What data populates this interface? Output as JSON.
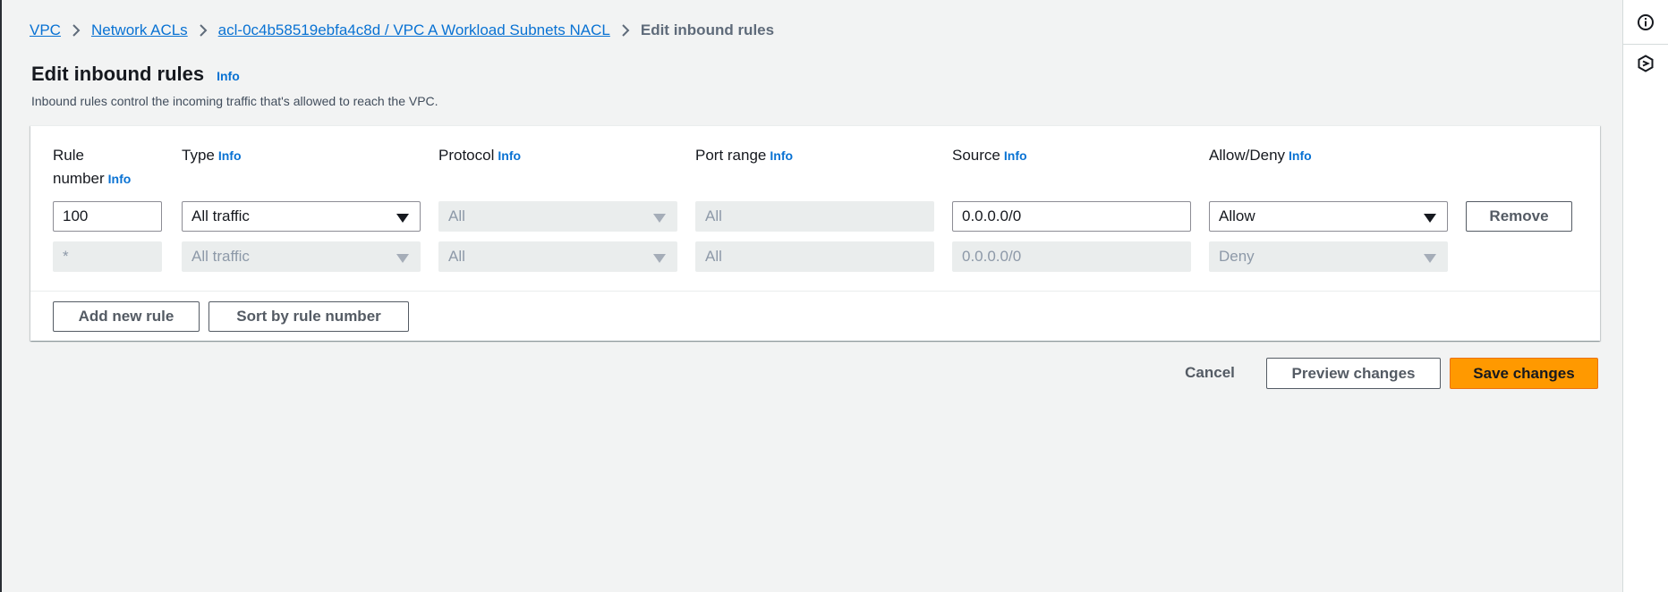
{
  "breadcrumb": {
    "items": [
      {
        "label": "VPC"
      },
      {
        "label": "Network ACLs"
      },
      {
        "label": "acl-0c4b58519ebfa4c8d / VPC A Workload Subnets NACL"
      }
    ],
    "current": "Edit inbound rules"
  },
  "header": {
    "title": "Edit inbound rules",
    "info": "Info",
    "description": "Inbound rules control the incoming traffic that's allowed to reach the VPC."
  },
  "columns": {
    "rule_number_line1": "Rule",
    "rule_number_line2": "number",
    "type": "Type",
    "protocol": "Protocol",
    "port_range": "Port range",
    "source": "Source",
    "allow_deny": "Allow/Deny",
    "info": "Info"
  },
  "rules": [
    {
      "rule_number": "100",
      "type": "All traffic",
      "protocol": "All",
      "port_range": "All",
      "source": "0.0.0.0/0",
      "allow_deny": "Allow",
      "remove_label": "Remove"
    },
    {
      "rule_number": "*",
      "type": "All traffic",
      "protocol": "All",
      "port_range": "All",
      "source": "0.0.0.0/0",
      "allow_deny": "Deny"
    }
  ],
  "card_actions": {
    "add_rule": "Add new rule",
    "sort": "Sort by rule number"
  },
  "footer": {
    "cancel": "Cancel",
    "preview": "Preview changes",
    "save": "Save changes"
  },
  "rail": {
    "icons": [
      "info-icon",
      "settings-hexagon-icon"
    ]
  },
  "colors": {
    "link": "#0972d3",
    "primary_button": "#ff9900",
    "background": "#f2f3f3"
  }
}
